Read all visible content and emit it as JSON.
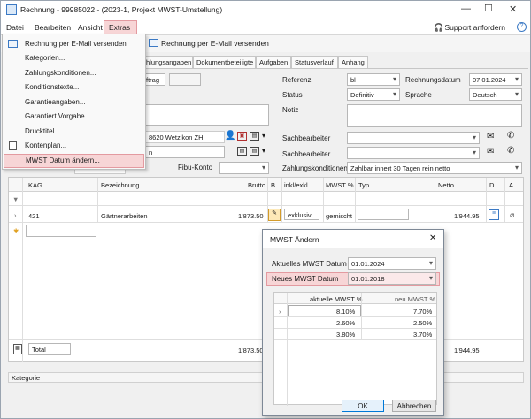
{
  "window": {
    "title": "Rechnung - 99985022 -  (2023-1, Projekt MWST-Umstellung)"
  },
  "menubar": {
    "items": [
      "Datei",
      "Bearbeiten",
      "Ansicht",
      "Extras"
    ],
    "support": "Support anfordern"
  },
  "toolbar": {
    "email_label": "Rechnung per E-Mail versenden"
  },
  "extras_menu": {
    "items": [
      "Rechnung per E-Mail versenden",
      "Kategorien...",
      "Zahlungskonditionen...",
      "Konditionstexte...",
      "Garantieangaben...",
      "Garantiert Vorgabe...",
      "Drucktitel...",
      "Kontenplan...",
      "MWST Datum ändern..."
    ]
  },
  "tabs": [
    "hlungsangaben",
    "Dokumentbeteiligte",
    "Aufgaben",
    "Statusverlauf",
    "Anhang"
  ],
  "form": {
    "auftrag_fragment": "ftrag",
    "address": "8620 Wetzikon ZH",
    "contact_fragment": "n",
    "fibu_konto_label": "Fibu-Konto",
    "referenz_label": "Referenz",
    "referenz_value": "bl",
    "rechnungsdatum_label": "Rechnungsdatum",
    "rechnungsdatum_value": "07.01.2024",
    "status_label": "Status",
    "status_value": "Definitiv",
    "sprache_label": "Sprache",
    "sprache_value": "Deutsch",
    "notiz_label": "Notiz",
    "sachbearbeiter_label_1": "Sachbearbeiter",
    "sachbearbeiter_label_2": "Sachbearbeiter",
    "zahlungskonditionen_label": "Zahlungskonditionen",
    "zahlungskonditionen_value": "Zahlbar innert 30 Tagen rein netto"
  },
  "grid": {
    "headers": [
      "KAG",
      "Bezeichnung",
      "Brutto",
      "B",
      "inkl/exkl",
      "MWST %",
      "Typ",
      "Netto",
      "D",
      "A"
    ],
    "row": {
      "kag": "421",
      "bezeichnung": "Gärtnerarbeiten",
      "brutto": "1'873.50",
      "inkl": "exklusiv",
      "mwst": "gemischt",
      "netto": "1'944.95"
    },
    "total_label": "Total",
    "total_brutto": "1'873.50",
    "total_netto": "1'944.95"
  },
  "bottom": {
    "kategorie": "Kategorie"
  },
  "dialog": {
    "title": "MWST Ändern",
    "aktuelles_label": "Aktuelles MWST Datum",
    "aktuelles_value": "01.01.2024",
    "neues_label": "Neues MWST Datum",
    "neues_value": "01.01.2018",
    "col_aktuell": "aktuelle MWST %",
    "col_neu": "neu MWST %",
    "rows": [
      {
        "aktuell": "8.10%",
        "neu": "7.70%"
      },
      {
        "aktuell": "2.60%",
        "neu": "2.50%"
      },
      {
        "aktuell": "3.80%",
        "neu": "3.70%"
      }
    ],
    "ok_label": "OK",
    "cancel_label": "Abbrechen"
  },
  "colors": {
    "highlight": "#f7d5d6",
    "highlight_border": "#e39aa0",
    "accent": "#0078d7"
  }
}
